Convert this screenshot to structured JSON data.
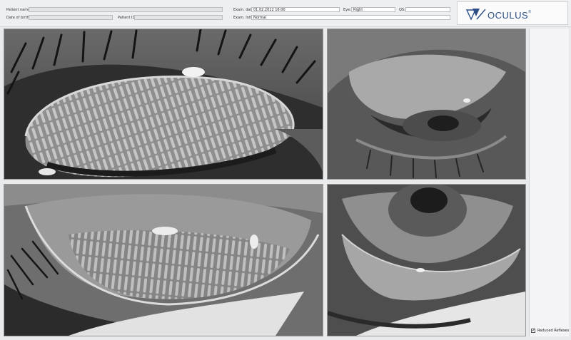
{
  "patient": {
    "name_label": "Patient name:",
    "name_value": "",
    "dob_label": "Date of birth:",
    "dob_value": "",
    "id_label": "Patient ID:",
    "id_value": ""
  },
  "exam": {
    "date_label": "Exam. date:",
    "date_value": "01.02.2012 16:00",
    "eye_label": "Eye:",
    "eye_value": "Right",
    "qs_label": "QS:",
    "qs_value": "",
    "info_label": "Exam. Info:",
    "info_value": "Normal"
  },
  "logo": {
    "brand": "OCULUS",
    "mark": "®"
  },
  "options": {
    "reduced_reflexes_label": "Reduced Reflexes",
    "reduced_reflexes_checked": "✓"
  },
  "colors": {
    "logo_blue": "#2d4f86",
    "background": "#e9eaec"
  },
  "images": [
    {
      "name": "everted upper lid meibography"
    },
    {
      "name": "upper eye lid view"
    },
    {
      "name": "everted lower lid meibography"
    },
    {
      "name": "lower eye lid view"
    }
  ]
}
